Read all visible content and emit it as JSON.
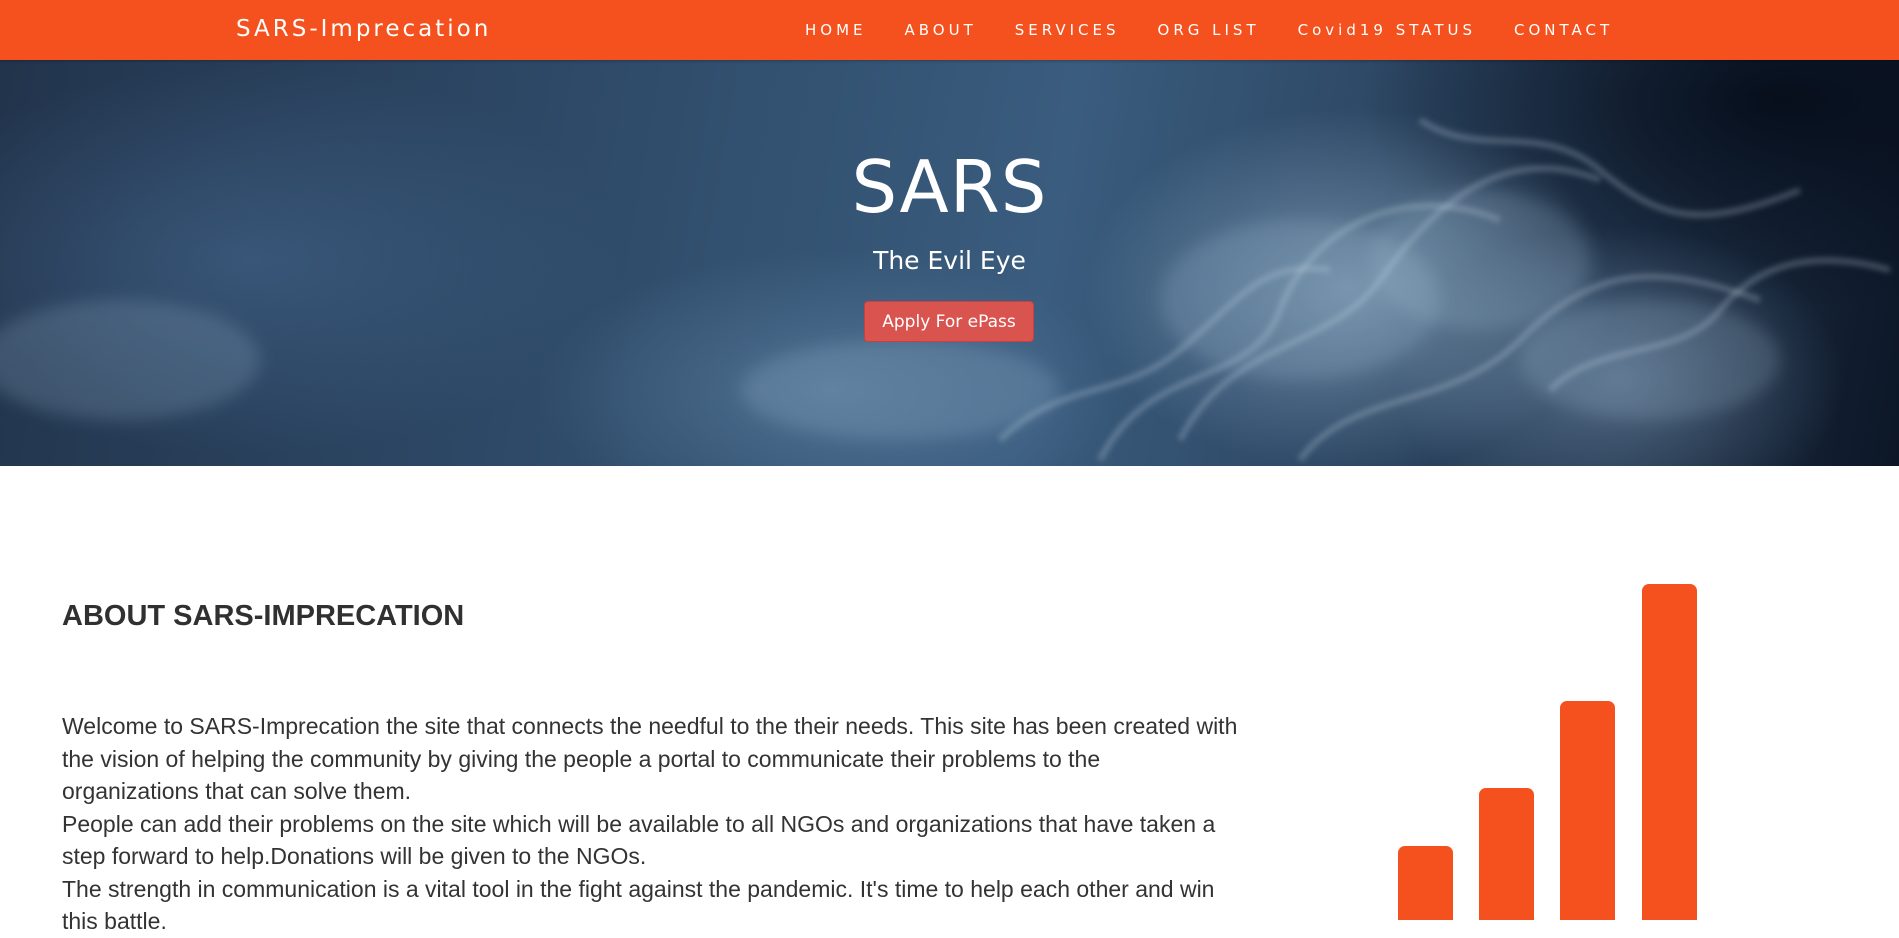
{
  "navbar": {
    "brand": "SARS-Imprecation",
    "items": [
      {
        "label": "HOME"
      },
      {
        "label": "ABOUT"
      },
      {
        "label": "SERVICES"
      },
      {
        "label": "ORG LIST"
      },
      {
        "label": "Covid19 STATUS"
      },
      {
        "label": "CONTACT"
      }
    ]
  },
  "hero": {
    "title": "SARS",
    "subtitle": "The Evil Eye",
    "button_label": "Apply For ePass"
  },
  "about": {
    "heading": "ABOUT SARS-IMPRECATION",
    "paragraphs": [
      "Welcome to SARS-Imprecation the site that connects the needful to the their needs. This site has been created with the vision of helping the community by giving the people a portal to communicate their problems to the organizations that can solve them.",
      "People can add their problems on the site which will be available to all NGOs and organizations that have taken a step forward to help.Donations will be given to the NGOs.",
      "The strength in communication is a vital tool in the fight against the pandemic. It's time to help each other and win this battle."
    ],
    "logo_icon": "signal-bars-icon"
  },
  "colors": {
    "accent": "#f4511e",
    "button": "#d9534f",
    "text": "#333333"
  }
}
